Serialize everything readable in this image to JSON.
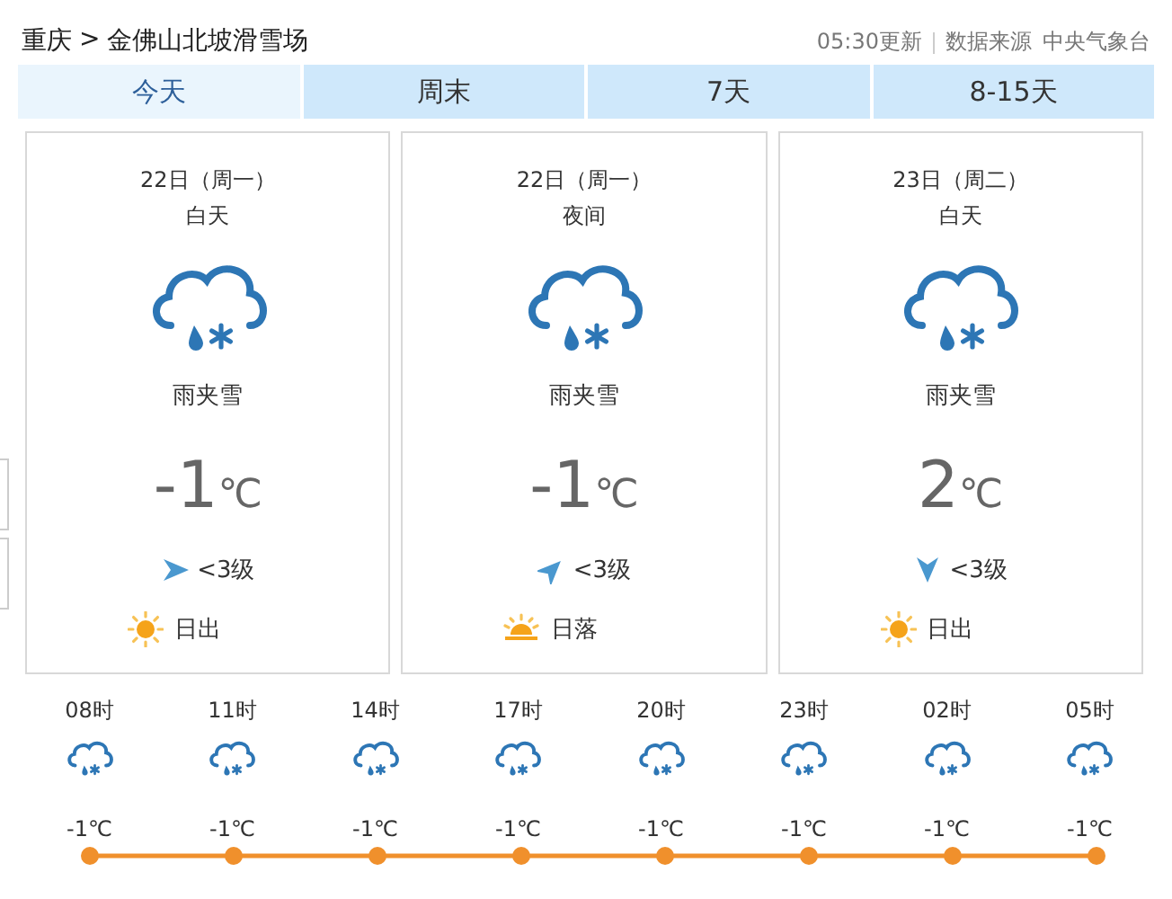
{
  "breadcrumb": {
    "region": "重庆",
    "separator": ">",
    "place": "金佛山北坡滑雪场"
  },
  "source": {
    "updated": "05:30更新",
    "label": "数据来源",
    "provider": "中央气象台"
  },
  "tabs": [
    {
      "label": "今天",
      "selected": true
    },
    {
      "label": "周末",
      "selected": false
    },
    {
      "label": "7天",
      "selected": false
    },
    {
      "label": "8-15天",
      "selected": false
    }
  ],
  "periods": [
    {
      "date": "22日（周一）",
      "part": "白天",
      "weather": "雨夹雪",
      "temp": "-1",
      "unit": "℃",
      "wind": {
        "kind": "east",
        "text": "<3级"
      },
      "sun": {
        "kind": "sunrise",
        "text": "日出"
      }
    },
    {
      "date": "22日（周一）",
      "part": "夜间",
      "weather": "雨夹雪",
      "temp": "-1",
      "unit": "℃",
      "wind": {
        "kind": "northeast",
        "text": "<3级"
      },
      "sun": {
        "kind": "sunset",
        "text": "日落"
      }
    },
    {
      "date": "23日（周二）",
      "part": "白天",
      "weather": "雨夹雪",
      "temp": "2",
      "unit": "℃",
      "wind": {
        "kind": "south",
        "text": "<3级"
      },
      "sun": {
        "kind": "sunrise",
        "text": "日出"
      }
    }
  ],
  "hourly": [
    {
      "time": "08时",
      "temp": "-1℃"
    },
    {
      "time": "11时",
      "temp": "-1℃"
    },
    {
      "time": "14时",
      "temp": "-1℃"
    },
    {
      "time": "17时",
      "temp": "-1℃"
    },
    {
      "time": "20时",
      "temp": "-1℃"
    },
    {
      "time": "23时",
      "temp": "-1℃"
    },
    {
      "time": "02时",
      "temp": "-1℃"
    },
    {
      "time": "05时",
      "temp": "-1℃"
    }
  ]
}
